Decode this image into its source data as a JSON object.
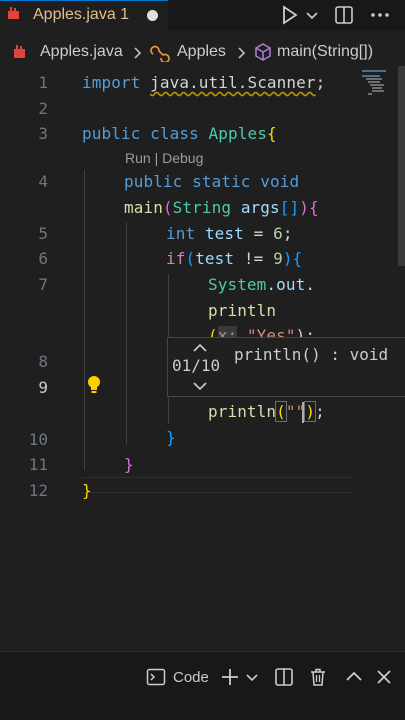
{
  "tab": {
    "label": "Apples.java 1"
  },
  "breadcrumb": {
    "file": "Apples.java",
    "class": "Apples",
    "method": "main(String[])"
  },
  "editor": {
    "line_numbers": [
      "1",
      "2",
      "3",
      "4",
      "5",
      "6",
      "7",
      "8",
      "9",
      "10",
      "11",
      "12"
    ],
    "codelens": "Run | Debug",
    "code": {
      "l1_kw": "import",
      "l1_pkg": "java.util.Scanner",
      "l1_semi": ";",
      "l3_public": "public",
      "l3_class": "class",
      "l3_name": "Apples",
      "l3_brace": "{",
      "l4_public": "public",
      "l4_static": "static",
      "l4_void": "void",
      "l5_main": "main",
      "l5_open": "(",
      "l5_type": "String",
      "l5_args": "args",
      "l5_arr": "[]",
      "l5_close": ")",
      "l5_brace": "{",
      "l6_type": "int",
      "l6_var": "test",
      "l6_eq": "=",
      "l6_num": "6",
      "l6_semi": ";",
      "l7_if": "if",
      "l7_open": "(",
      "l7_var": "test",
      "l7_op": "!=",
      "l7_num": "9",
      "l7_close": ")",
      "l7_brace": "{",
      "l8_system": "System",
      "l8_dot": ".",
      "l8_out": "out",
      "l8_dot2": ".",
      "l9_println": "println",
      "l10_open": "(",
      "l10_x": "x:",
      "l10_str": "\"Yes\"",
      "l10_close": ");",
      "l13_println": "println",
      "l13_open": "(",
      "l13_str": "\"\"",
      "l13_close": ")",
      "l13_semi": ";",
      "l14_brace": "}",
      "l15_brace": "}",
      "l16_brace": "}"
    }
  },
  "hint": {
    "count": "01/10",
    "signature": "println() : void"
  },
  "panel": {
    "code_label": "Code"
  },
  "colors": {
    "accent": "#0078d4",
    "modified_tab": "#e2c08d",
    "java_icon": "#e0453b",
    "bulb": "#ffcc00"
  }
}
